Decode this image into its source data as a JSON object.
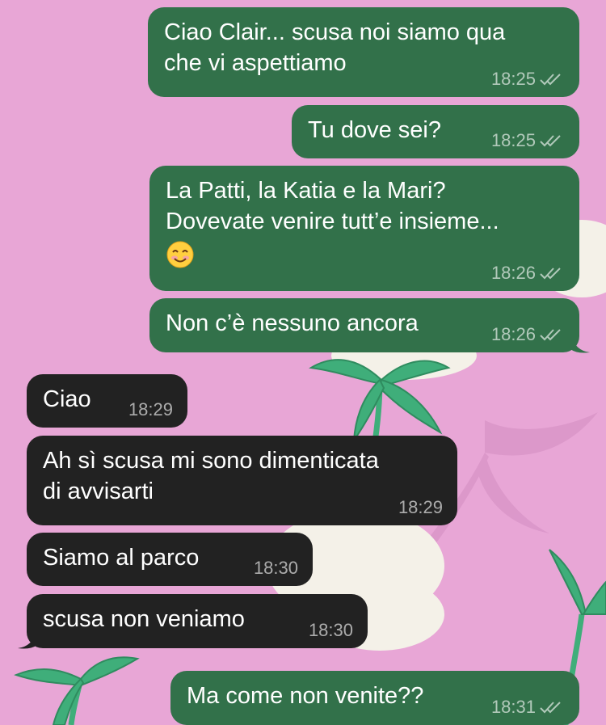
{
  "chat": {
    "messages": [
      {
        "id": "m1",
        "direction": "outgoing",
        "text": "Ciao Clair... scusa noi siamo qua\nche vi aspettiamo",
        "time": "18:25",
        "status": "read"
      },
      {
        "id": "m2",
        "direction": "outgoing",
        "text": "Tu dove sei?",
        "time": "18:25",
        "status": "read"
      },
      {
        "id": "m3",
        "direction": "outgoing",
        "text": "La Patti, la Katia e la Mari?\nDovevate venire tutt’e insieme...",
        "emoji": "smiling-face-emoji",
        "time": "18:26",
        "status": "read"
      },
      {
        "id": "m4",
        "direction": "outgoing",
        "text": "Non c’è nessuno ancora",
        "time": "18:26",
        "status": "read"
      },
      {
        "id": "m5",
        "direction": "incoming",
        "text": "Ciao",
        "time": "18:29"
      },
      {
        "id": "m6",
        "direction": "incoming",
        "text": "Ah sì scusa mi sono dimenticata\ndi avvisarti",
        "time": "18:29"
      },
      {
        "id": "m7",
        "direction": "incoming",
        "text": "Siamo al parco",
        "time": "18:30"
      },
      {
        "id": "m8",
        "direction": "incoming",
        "text": "scusa non veniamo",
        "time": "18:30"
      },
      {
        "id": "m9",
        "direction": "outgoing",
        "text": "Ma come non venite??",
        "time": "18:31",
        "status": "read"
      }
    ]
  },
  "colors": {
    "wallpaper": "#e8a6d6",
    "outgoing_bubble": "#32714a",
    "incoming_bubble": "#222222",
    "text": "#ffffff"
  },
  "icons": {
    "read_receipt": "double-check-icon"
  }
}
